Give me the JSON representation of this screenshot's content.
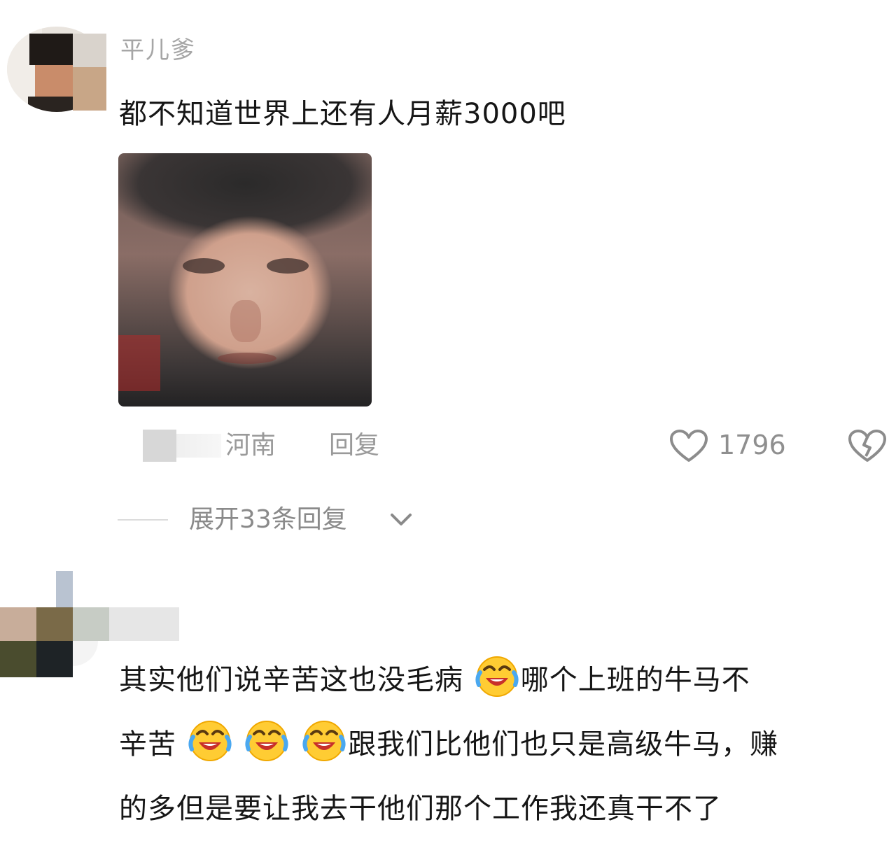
{
  "comments": [
    {
      "username": "平儿爹",
      "text": "都不知道世界上还有人月薪3000吧",
      "location": "河南",
      "reply_label": "回复",
      "like_count": "1796",
      "expand_label": "展开33条回复",
      "icons": {
        "like": "heart-outline-icon",
        "dislike": "broken-heart-icon",
        "expand": "chevron-down-icon"
      }
    },
    {
      "text_lines": [
        {
          "before": "其实他们说辛苦这也没毛病",
          "emojis": 1,
          "after": "哪个上班的牛马不"
        },
        {
          "before": "辛苦",
          "emojis": 3,
          "after": "跟我们比他们也只是高级牛马，赚"
        },
        {
          "before": "的多但是要让我去干他们那个工作我还真干不了",
          "emojis": 0,
          "after": ""
        }
      ],
      "emoji_icon": "laughing-crying-emoji-icon"
    }
  ]
}
